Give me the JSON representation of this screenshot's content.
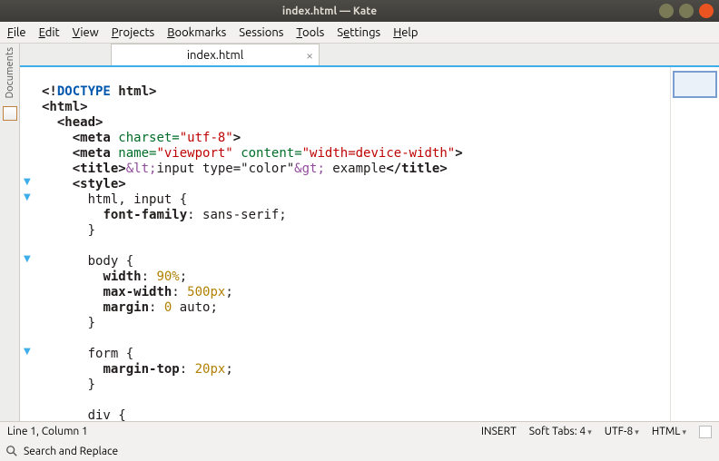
{
  "window": {
    "title": "index.html — Kate"
  },
  "menu": {
    "file": "File",
    "edit": "Edit",
    "view": "View",
    "projects": "Projects",
    "bookmarks": "Bookmarks",
    "sessions": "Sessions",
    "tools": "Tools",
    "settings": "Settings",
    "help": "Help"
  },
  "sidebar": {
    "documents": "Documents"
  },
  "tab": {
    "name": "index.html"
  },
  "code": {
    "l1": "",
    "l2a": "<!",
    "l2b": "DOCTYPE",
    "l2c": " html",
    "l2d": ">",
    "l3": "<html>",
    "l4": "  <head>",
    "l5a": "    <meta ",
    "l5b": "charset=",
    "l5c": "\"utf-8\"",
    "l5d": ">",
    "l6a": "    <meta ",
    "l6b": "name=",
    "l6c": "\"viewport\"",
    "l6d": " ",
    "l6e": "content=",
    "l6f": "\"width=device-width\"",
    "l6g": ">",
    "l7a": "    <title>",
    "l7b": "&lt;",
    "l7c": "input type=\"color\"",
    "l7d": "&gt;",
    "l7e": " example",
    "l7f": "</title>",
    "l8": "    <style>",
    "l9": "      html, input {",
    "l10a": "        ",
    "l10b": "font-family",
    "l10c": ": sans-serif;",
    "l11": "      }",
    "l12": "",
    "l13": "      body {",
    "l14a": "        ",
    "l14b": "width",
    "l14c": ": ",
    "l14d": "90%",
    "l14e": ";",
    "l15a": "        ",
    "l15b": "max-width",
    "l15c": ": ",
    "l15d": "500px",
    "l15e": ";",
    "l16a": "        ",
    "l16b": "margin",
    "l16c": ": ",
    "l16d": "0",
    "l16e": " auto;",
    "l17": "      }",
    "l18": "",
    "l19": "      form {",
    "l20a": "        ",
    "l20b": "margin-top",
    "l20c": ": ",
    "l20d": "20px",
    "l20e": ";",
    "l21": "      }",
    "l22": "",
    "l23": "      div {"
  },
  "status": {
    "pos": "Line 1, Column 1",
    "mode": "INSERT",
    "tabs": "Soft Tabs: 4",
    "enc": "UTF-8",
    "lang": "HTML"
  },
  "search": {
    "label": "Search and Replace"
  },
  "colors": {
    "min": "#7a7a56",
    "max": "#df4f1c",
    "close": "#e95420"
  }
}
